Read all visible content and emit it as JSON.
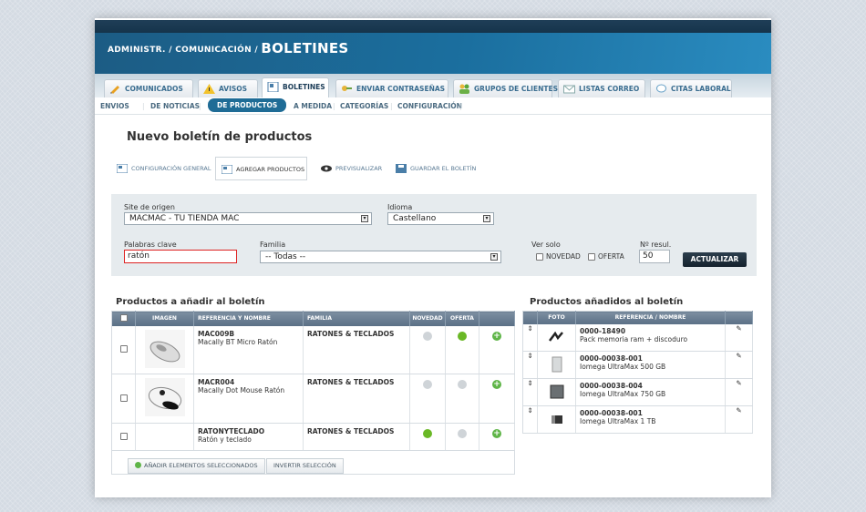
{
  "header": {
    "breadcrumb": "ADMINISTR. / COMUNICACIÓN /",
    "section": "BOLETINES"
  },
  "tabs": [
    {
      "label": "COMUNICADOS",
      "icon": "pencil-icon"
    },
    {
      "label": "AVISOS",
      "icon": "warning-icon"
    },
    {
      "label": "BOLETINES",
      "icon": "newsletter-icon",
      "active": true
    },
    {
      "label": "ENVIAR CONTRASEÑAS",
      "icon": "key-icon"
    },
    {
      "label": "GRUPOS DE CLIENTES",
      "icon": "group-icon"
    },
    {
      "label": "LISTAS CORREO",
      "icon": "mail-list-icon"
    },
    {
      "label": "CITAS LABORAL",
      "icon": "chat-icon"
    }
  ],
  "subnav": [
    "ENVIOS",
    "DE NOTICIAS",
    "DE PRODUCTOS",
    "A MEDIDA",
    "CATEGORÍAS",
    "CONFIGURACIÓN"
  ],
  "page_title": "Nuevo boletín de productos",
  "steps": [
    "CONFIGURACIÓN GENERAL",
    "AGREGAR PRODUCTOS",
    "PREVISUALIZAR",
    "GUARDAR EL BOLETÍN"
  ],
  "filters": {
    "site_label": "Site de origen",
    "site_value": "MACMAC - TU TIENDA MAC",
    "idioma_label": "Idioma",
    "idioma_value": "Castellano",
    "keywords_label": "Palabras clave",
    "keywords_value": "ratón",
    "familia_label": "Familia",
    "familia_value": "-- Todas --",
    "versolo_label": "Ver solo",
    "novedad_label": "NOVEDAD",
    "oferta_label": "OFERTA",
    "nresul_label": "Nº resul.",
    "nresul_value": "50",
    "update_button": "ACTUALIZAR"
  },
  "left": {
    "title": "Productos a añadir al boletín",
    "columns": [
      "IMAGEN",
      "REFERENCIA Y NOMBRE",
      "FAMILIA",
      "NOVEDAD",
      "OFERTA"
    ],
    "rows": [
      {
        "ref": "MAC009B",
        "name": "Macally BT Micro Ratón",
        "family": "RATONES & TECLADOS",
        "novedad": false,
        "oferta": true
      },
      {
        "ref": "MACR004",
        "name": "Macally Dot Mouse Ratón",
        "family": "RATONES & TECLADOS",
        "novedad": false,
        "oferta": false
      },
      {
        "ref": "RATONYTECLADO",
        "name": "Ratón y teclado",
        "family": "RATONES & TECLADOS",
        "novedad": true,
        "oferta": false
      }
    ],
    "add_button": "AÑADIR ELEMENTOS SELECCIONADOS",
    "invert_button": "INVERTIR SELECCIÓN"
  },
  "right": {
    "title": "Productos añadidos al boletín",
    "columns": [
      "FOTO",
      "REFERENCIA / NOMBRE"
    ],
    "rows": [
      {
        "ref": "0000-18490",
        "name": "Pack memoria ram + discoduro"
      },
      {
        "ref": "0000-00038-001",
        "name": "Iomega UltraMax 500 GB"
      },
      {
        "ref": "0000-00038-004",
        "name": "Iomega UltraMax 750 GB"
      },
      {
        "ref": "0000-00038-001",
        "name": "Iomega UltraMax 1 TB"
      }
    ]
  },
  "colors": {
    "accent": "#1f6c96",
    "header": "#1b6f9f",
    "green": "#6ab826"
  }
}
